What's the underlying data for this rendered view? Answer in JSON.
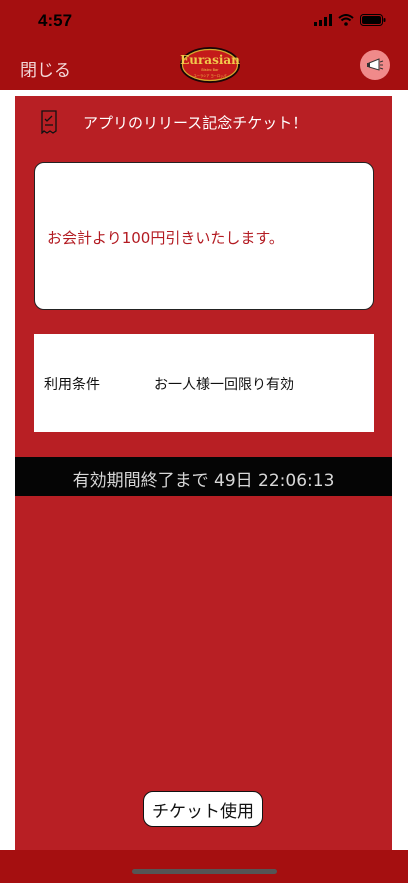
{
  "status_bar": {
    "time": "4:57"
  },
  "nav": {
    "close_label": "閉じる",
    "logo_name": "Eurasian",
    "logo_sub": "Bistro Bar",
    "logo_tagline": "ユーラシア ヨーロッパ"
  },
  "ticket": {
    "title": "アプリのリリース記念チケット！",
    "message": "お会計より100円引きいたします。",
    "condition_label": "利用条件",
    "condition_value": "お一人様一回限り有効",
    "countdown": "有効期間終了まで 49日 22:06:13",
    "use_button_label": "チケット使用"
  },
  "colors": {
    "nav_background": "#a50f10",
    "card_background": "#b81f24",
    "message_text": "#b31b22",
    "countdown_background": "#050505"
  },
  "icons": {
    "ticket": "receipt-icon",
    "share": "megaphone-icon",
    "signal": "cellular-signal-icon",
    "wifi": "wifi-icon",
    "battery": "battery-icon"
  }
}
